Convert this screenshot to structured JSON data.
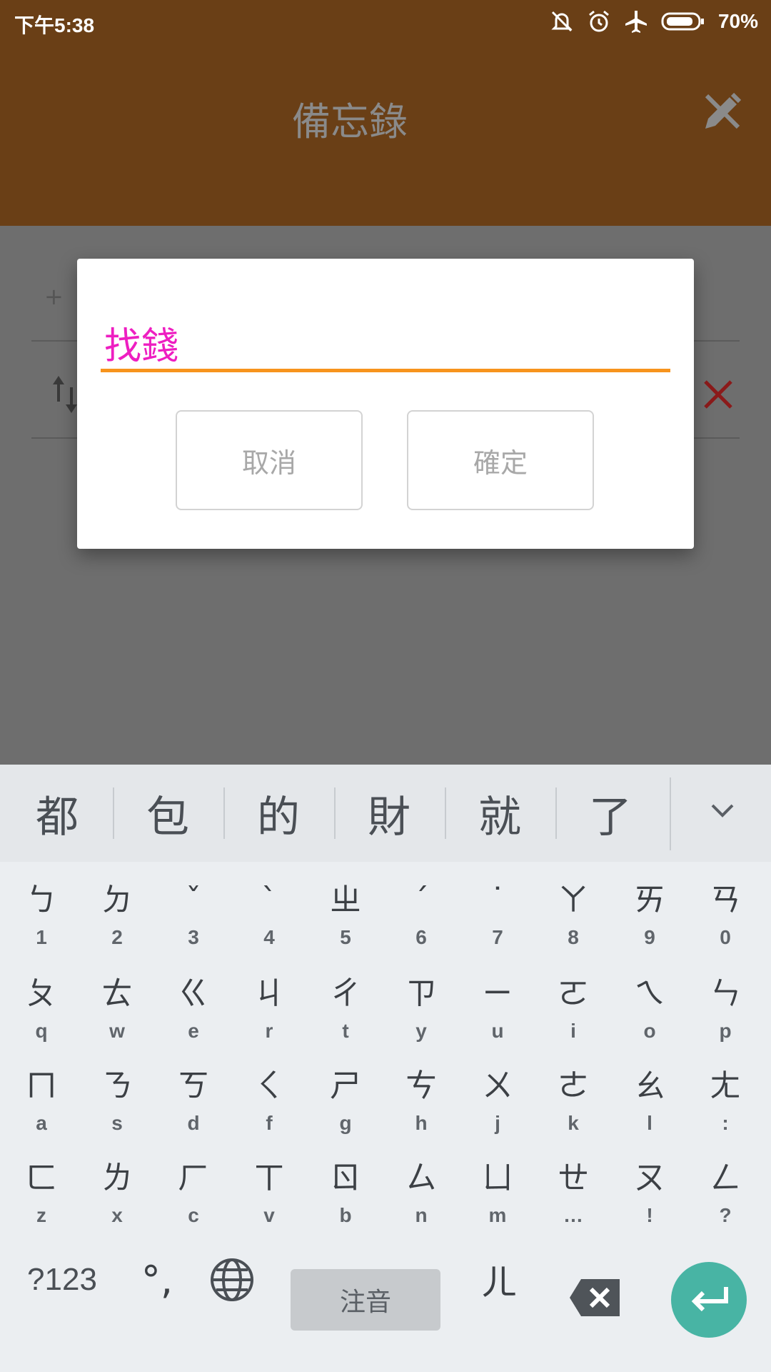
{
  "status_bar": {
    "time": "下午5:38",
    "battery": "70%"
  },
  "app_bar": {
    "title": "備忘錄"
  },
  "list": {
    "add_symbol": "+"
  },
  "dialog": {
    "input_value": "找錢",
    "cancel_label": "取消",
    "ok_label": "確定"
  },
  "keyboard": {
    "candidates": [
      "都",
      "包",
      "的",
      "財",
      "就",
      "了"
    ],
    "rows": [
      [
        {
          "main": "ㄅ",
          "sub": "1"
        },
        {
          "main": "ㄉ",
          "sub": "2"
        },
        {
          "main": "ˇ",
          "sub": "3"
        },
        {
          "main": "ˋ",
          "sub": "4"
        },
        {
          "main": "ㄓ",
          "sub": "5"
        },
        {
          "main": "ˊ",
          "sub": "6"
        },
        {
          "main": "˙",
          "sub": "7"
        },
        {
          "main": "ㄚ",
          "sub": "8"
        },
        {
          "main": "ㄞ",
          "sub": "9"
        },
        {
          "main": "ㄢ",
          "sub": "0"
        }
      ],
      [
        {
          "main": "ㄆ",
          "sub": "q"
        },
        {
          "main": "ㄊ",
          "sub": "w"
        },
        {
          "main": "ㄍ",
          "sub": "e"
        },
        {
          "main": "ㄐ",
          "sub": "r"
        },
        {
          "main": "ㄔ",
          "sub": "t"
        },
        {
          "main": "ㄗ",
          "sub": "y"
        },
        {
          "main": "ㄧ",
          "sub": "u"
        },
        {
          "main": "ㄛ",
          "sub": "i"
        },
        {
          "main": "ㄟ",
          "sub": "o"
        },
        {
          "main": "ㄣ",
          "sub": "p"
        }
      ],
      [
        {
          "main": "ㄇ",
          "sub": "a"
        },
        {
          "main": "ㄋ",
          "sub": "s"
        },
        {
          "main": "ㄎ",
          "sub": "d"
        },
        {
          "main": "ㄑ",
          "sub": "f"
        },
        {
          "main": "ㄕ",
          "sub": "g"
        },
        {
          "main": "ㄘ",
          "sub": "h"
        },
        {
          "main": "ㄨ",
          "sub": "j"
        },
        {
          "main": "ㄜ",
          "sub": "k"
        },
        {
          "main": "ㄠ",
          "sub": "l"
        },
        {
          "main": "ㄤ",
          "sub": ":"
        }
      ],
      [
        {
          "main": "ㄈ",
          "sub": "z"
        },
        {
          "main": "ㄌ",
          "sub": "x"
        },
        {
          "main": "ㄏ",
          "sub": "c"
        },
        {
          "main": "ㄒ",
          "sub": "v"
        },
        {
          "main": "ㄖ",
          "sub": "b"
        },
        {
          "main": "ㄙ",
          "sub": "n"
        },
        {
          "main": "ㄩ",
          "sub": "m"
        },
        {
          "main": "ㄝ",
          "sub": "…"
        },
        {
          "main": "ㄡ",
          "sub": "!"
        },
        {
          "main": "ㄥ",
          "sub": "?"
        }
      ]
    ],
    "bottom": {
      "symbols": "?123",
      "punct": "°,",
      "space": "注音",
      "er": "ㄦ"
    }
  },
  "colors": {
    "app_bar": "#6a3f16",
    "input_text": "#ee1ec1",
    "underline": "#f7941d",
    "enter": "#48b4a4",
    "delete": "#8b1a1a"
  },
  "icons": [
    "mute-icon",
    "alarm-icon",
    "airplane-icon",
    "battery-icon",
    "edit-icon",
    "add-icon",
    "sort-icon",
    "delete-icon",
    "expand-icon",
    "globe-icon",
    "backspace-icon",
    "enter-icon"
  ]
}
